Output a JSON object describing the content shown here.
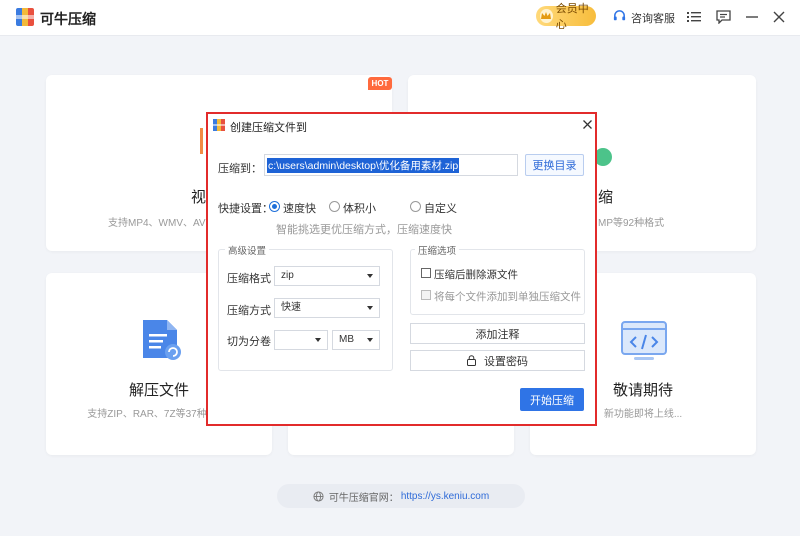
{
  "app": {
    "name": "可牛压缩"
  },
  "titlebar": {
    "vip_label": "会员中心",
    "support_label": "咨询客服"
  },
  "cards": {
    "video": {
      "title_fragment": "视",
      "sub_fragment": "支持MP4、WMV、AVI、"
    },
    "hot_badge": "HOT",
    "image": {
      "title_fragment": "缩",
      "sub_fragment": "MP等92种格式"
    },
    "extract": {
      "title": "解压文件",
      "sub": "支持ZIP、RAR、7Z等37种归档"
    },
    "coming": {
      "title": "敬请期待",
      "sub": "新功能即将上线..."
    }
  },
  "website": {
    "label": "可牛压缩官网：",
    "url": "https://ys.keniu.com"
  },
  "dialog": {
    "title": "创建压缩文件到",
    "compress_to_label": "压缩到：",
    "path": "c:\\users\\admin\\desktop\\优化备用素材.zip",
    "change_dir_button": "更换目录",
    "quick_label": "快捷设置：",
    "quick_options": [
      "速度快",
      "体积小",
      "自定义"
    ],
    "quick_selected": "速度快",
    "quick_hint": "智能挑选更优压缩方式，压缩速度快",
    "advanced": {
      "title": "高级设置",
      "format_label": "压缩格式",
      "format_value": "zip",
      "method_label": "压缩方式",
      "method_value": "快速",
      "split_label": "切为分卷",
      "split_value": "",
      "split_unit": "MB"
    },
    "options": {
      "title": "压缩选项",
      "delete_source": "压缩后删除源文件",
      "each_separate": "将每个文件添加到单独压缩文件"
    },
    "add_comment_button": "添加注释",
    "set_password_button": "设置密码",
    "start_button": "开始压缩"
  },
  "colors": {
    "accent": "#2f74e6",
    "highlight_border": "#e22b2b",
    "hot": "#ff6a3d",
    "vip": "#f7bd3c"
  }
}
